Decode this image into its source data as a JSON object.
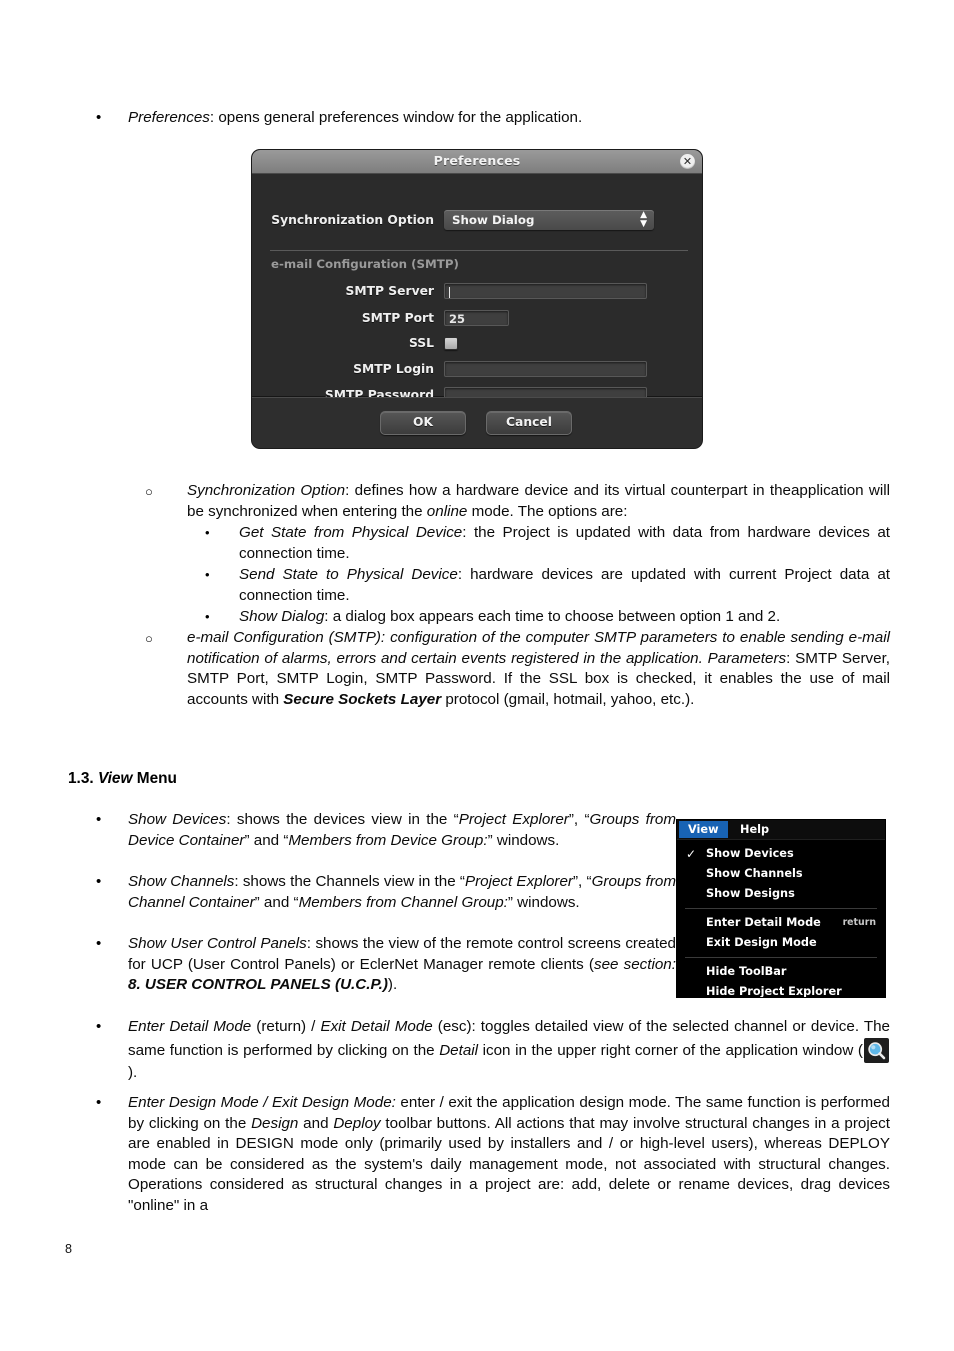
{
  "page": {
    "number": "8"
  },
  "intro_bullet": {
    "term": "Preferences",
    "rest": ": opens general preferences window for the application."
  },
  "preferences_dialog": {
    "title": "Preferences",
    "close_icon": "close-icon",
    "sync_label": "Synchronization Option",
    "sync_value": "Show Dialog",
    "section_label": "e-mail Configuration (SMTP)",
    "fields": [
      {
        "label": "SMTP Server",
        "value": ""
      },
      {
        "label": "SMTP Port",
        "value": "25"
      },
      {
        "label": "SSL",
        "value": ""
      },
      {
        "label": "SMTP Login",
        "value": ""
      },
      {
        "label": "SMTP Password",
        "value": ""
      }
    ],
    "ok_label": "OK",
    "cancel_label": "Cancel"
  },
  "sync_option": {
    "term": "Synchronization Option",
    "line1": ": defines how a hardware device and its virtual counterpart in the",
    "line2_a": "application will be synchronized when entering the ",
    "line2_i": "online",
    "line2_b": " mode. The options are:",
    "options": [
      {
        "term": "Get State from Physical Device",
        "rest": ": the Project is updated with data from hardware devices at connection time."
      },
      {
        "term": "Send State to Physical Device",
        "rest": ": hardware devices are updated with current Project data at connection time."
      },
      {
        "term": "Show Dialog",
        "rest": ": a dialog box appears each time to choose between option 1 and 2."
      }
    ]
  },
  "email_config": {
    "italic_part": "e-mail Configuration (SMTP): configuration of the computer SMTP parameters to enable sending e-mail notification of alarms, errors and certain events registered in the application. Parameters",
    "plain_part": ": SMTP Server, SMTP Port, SMTP Login, SMTP Password. If the SSL box is checked, it enables the use of mail accounts with ",
    "bold_part": "Secure Sockets Layer",
    "tail": " protocol (gmail, hotmail, yahoo, etc.)."
  },
  "view_section": {
    "heading_num": "1.3.",
    "heading_italic": "View",
    "heading_rest": "Menu"
  },
  "view_menu": {
    "menubar": [
      {
        "label": "View",
        "selected": true
      },
      {
        "label": "Help",
        "selected": false
      }
    ],
    "groups": [
      [
        {
          "label": "Show Devices",
          "checked": true,
          "shortcut": ""
        },
        {
          "label": "Show Channels",
          "checked": false,
          "shortcut": ""
        },
        {
          "label": "Show Designs",
          "checked": false,
          "shortcut": ""
        }
      ],
      [
        {
          "label": "Enter Detail Mode",
          "checked": false,
          "shortcut": "return"
        },
        {
          "label": "Exit Design Mode",
          "checked": false,
          "shortcut": ""
        }
      ],
      [
        {
          "label": "Hide ToolBar",
          "checked": false,
          "shortcut": ""
        },
        {
          "label": "Hide Project Explorer",
          "checked": false,
          "shortcut": ""
        }
      ]
    ]
  },
  "bullets": {
    "show_devices": {
      "term": "Show Devices",
      "t1": ": shows the devices view in the “",
      "q1": "Project Explorer",
      "t2": "”, “",
      "q2": "Groups from Device Container",
      "t3": "” and “",
      "q3": "Members from Device Group:",
      "t4": "” windows."
    },
    "show_channels": {
      "term": "Show Channels",
      "t1": ": shows the Channels view in the “",
      "q1": "Project Explorer",
      "t2": "”, “",
      "q2": "Groups from Channel Container",
      "t3": "” and “",
      "q3": "Members from Channel Group:",
      "t4": "” windows."
    },
    "show_ucp": {
      "term": "Show User Control Panels",
      "t1": ": shows the view of the remote control screens created for UCP (User Control Panels) or EclerNet Manager remote clients (",
      "i1": "see section: ",
      "b1": "8. USER CONTROL PANELS (U.C.P.)",
      "t2": ")."
    },
    "detail_mode": {
      "i1": "Enter Detail Mode",
      "t1": " (return) / ",
      "i2": "Exit Detail Mode",
      "t2": " (esc): toggles detailed view of the selected channel or device. The same function is performed by clicking on the ",
      "i3": "Detail",
      "t3": " icon in the upper right corner of the application window (",
      "icon": "detail-magnifier-icon",
      "t4": ")."
    },
    "design_mode": {
      "i1": "Enter Design Mode / Exit Design Mode:",
      "t1": " enter / exit the application design mode. The same function is performed by clicking on the ",
      "i2": "Design",
      "t2": " and ",
      "i3": "Deploy",
      "t3": " toolbar buttons. All actions that may involve structural changes in a project are enabled in DESIGN mode only (primarily used by installers and / or high-level users), whereas DEPLOY mode can be considered as the system's daily management mode, not associated with structural changes. Operations considered as structural changes in a project are: add, delete or rename devices, drag devices \"online\" in a"
    }
  },
  "colors": {
    "menu_highlight": "#1863b4",
    "dialog_bg": "#2b2b2b",
    "titlebar": "#8a8a8a"
  }
}
